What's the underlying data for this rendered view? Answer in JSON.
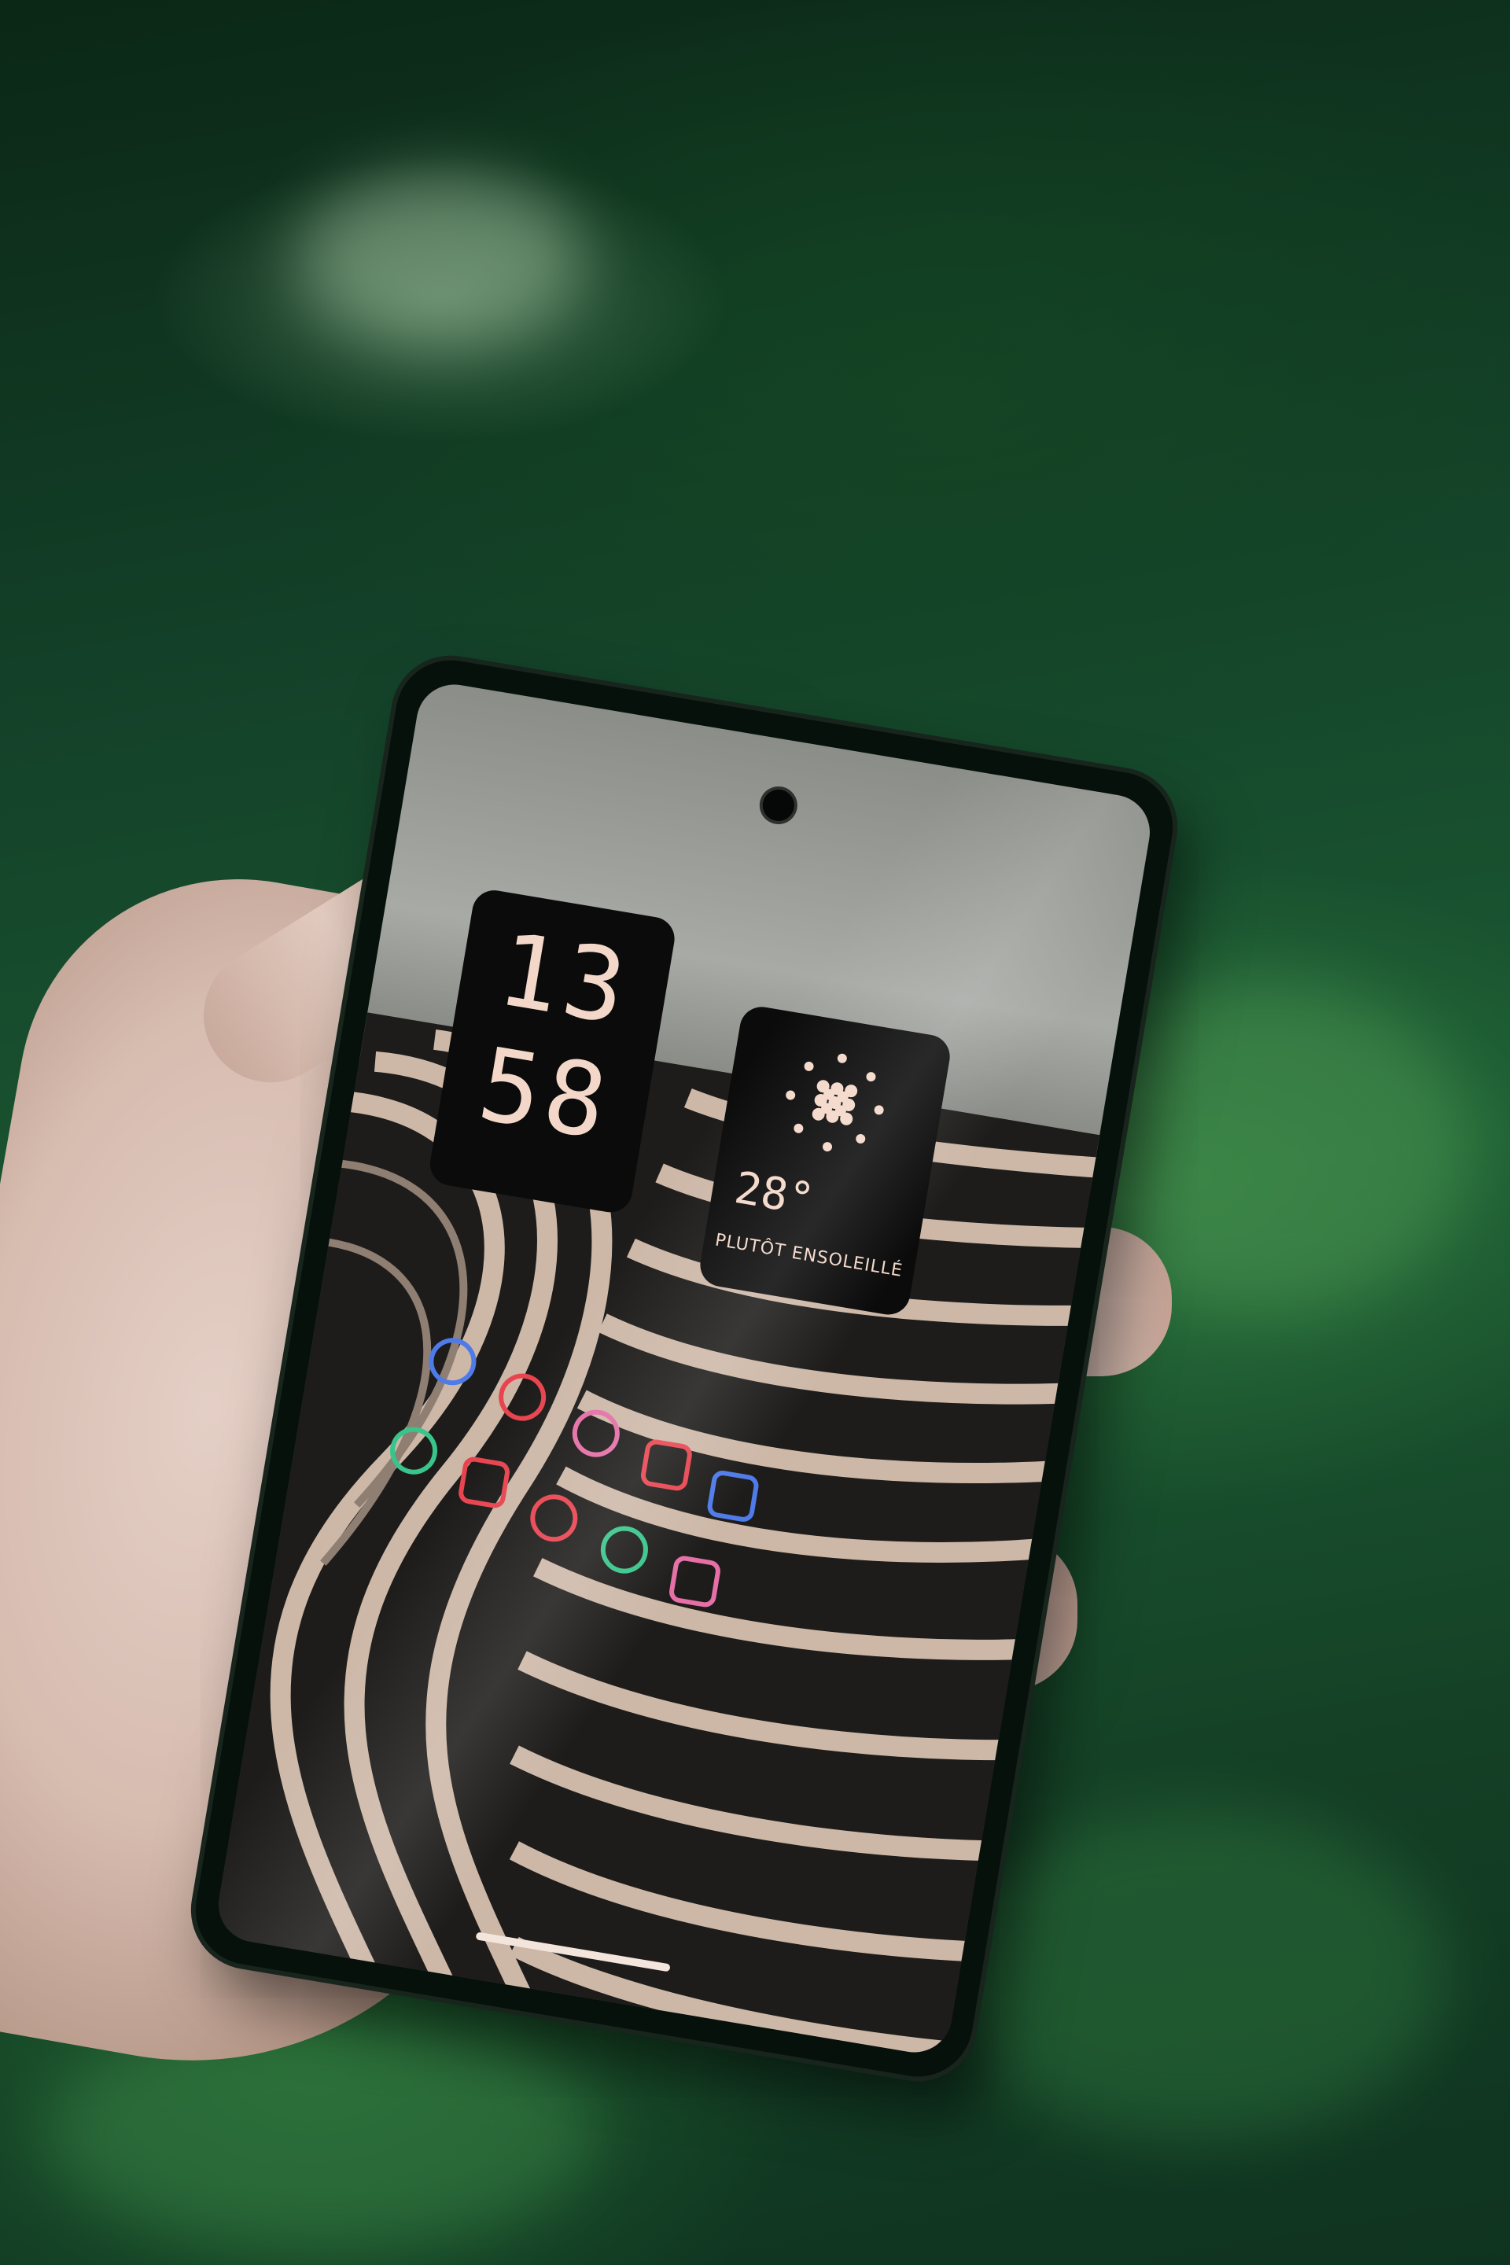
{
  "lock_screen": {
    "clock": {
      "hours": "13",
      "minutes": "58"
    },
    "weather": {
      "temperature": "28°",
      "condition": "PLUTÔT ENSOLEILLÉ"
    },
    "icons": [
      "assistant-icon",
      "chrome-icon",
      "camera-icon",
      "youtube-icon",
      "photos-icon",
      "lens-icon",
      "gmail-icon",
      "maps-icon",
      "wifi-icon",
      "store-icon"
    ]
  },
  "colors": {
    "widget_bg": "#0b0b0b",
    "widget_text": "#f3d8c9",
    "icon_red": "#e8444f",
    "icon_green": "#38c48a",
    "icon_pink": "#e56fa6",
    "icon_blue": "#4f7be8"
  }
}
